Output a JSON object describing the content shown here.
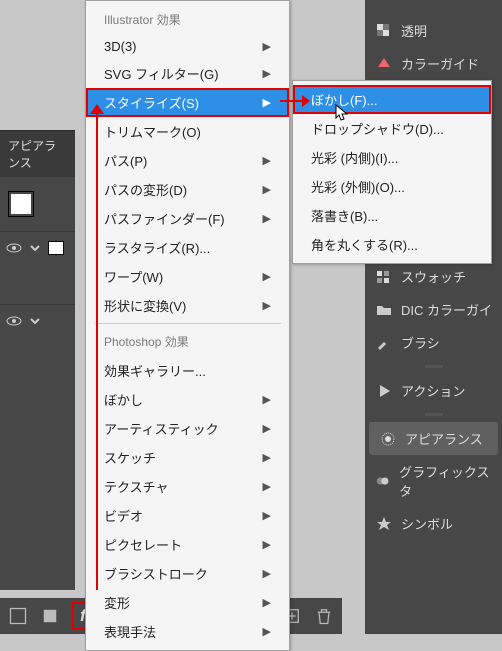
{
  "appearance_panel": {
    "title": "アピアランス"
  },
  "menu": {
    "header_illustrator": "Illustrator 効果",
    "header_photoshop": "Photoshop 効果",
    "items_illustrator": [
      {
        "label": "3D(3)",
        "sub": true
      },
      {
        "label": "SVG フィルター(G)",
        "sub": true
      },
      {
        "label": "スタイライズ(S)",
        "sub": true,
        "highlight": true
      },
      {
        "label": "トリムマーク(O)"
      },
      {
        "label": "パス(P)",
        "sub": true
      },
      {
        "label": "パスの変形(D)",
        "sub": true
      },
      {
        "label": "パスファインダー(F)",
        "sub": true
      },
      {
        "label": "ラスタライズ(R)..."
      },
      {
        "label": "ワープ(W)",
        "sub": true
      },
      {
        "label": "形状に変換(V)",
        "sub": true
      }
    ],
    "items_photoshop": [
      {
        "label": "効果ギャラリー..."
      },
      {
        "label": "ぼかし",
        "sub": true
      },
      {
        "label": "アーティスティック",
        "sub": true
      },
      {
        "label": "スケッチ",
        "sub": true
      },
      {
        "label": "テクスチャ",
        "sub": true
      },
      {
        "label": "ビデオ",
        "sub": true
      },
      {
        "label": "ピクセレート",
        "sub": true
      },
      {
        "label": "ブラシストローク",
        "sub": true
      },
      {
        "label": "変形",
        "sub": true
      },
      {
        "label": "表現手法",
        "sub": true
      }
    ]
  },
  "submenu": {
    "items": [
      {
        "label": "ぼかし(F)...",
        "highlight": true
      },
      {
        "label": "ドロップシャドウ(D)..."
      },
      {
        "label": "光彩 (内側)(I)..."
      },
      {
        "label": "光彩 (外側)(O)..."
      },
      {
        "label": "落書き(B)..."
      },
      {
        "label": "角を丸くする(R)..."
      }
    ]
  },
  "right_tabs": {
    "group1": [
      "透明",
      "カラーガイド"
    ],
    "group2": [
      "スウォッチ",
      "DIC カラーガイ",
      "ブラシ"
    ],
    "group3": [
      "アクション"
    ],
    "group4": [
      "アピアランス",
      "グラフィックスタ",
      "シンボル"
    ]
  },
  "bottom": {
    "fx_label": "fx."
  },
  "colors": {
    "highlight": "#2e8fe6",
    "annotation": "#e00000"
  }
}
